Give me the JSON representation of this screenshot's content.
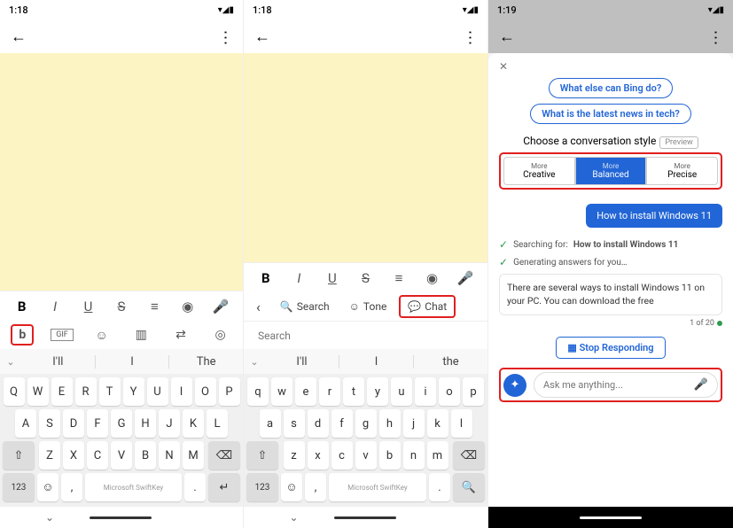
{
  "time1": "1:18",
  "time2": "1:18",
  "time3": "1:19",
  "signals": "▾◢▮",
  "fmt": {
    "b": "B",
    "i": "I",
    "u": "U",
    "s": "S",
    "list": "≡",
    "cam": "◉",
    "mic": "🎤"
  },
  "toolbar": {
    "bing": "b",
    "gif": "GIF",
    "sticker": "☺",
    "clip": "▥",
    "trans": "⇄",
    "set": "◎"
  },
  "modes": {
    "back": "‹",
    "search": "Search",
    "tone": "Tone",
    "chat": "Chat",
    "placeholder": "Search"
  },
  "pred1": {
    "w1": "I'll",
    "w2": "I",
    "w3": "The"
  },
  "pred2": {
    "w1": "I'll",
    "w2": "I",
    "w3": "the"
  },
  "keys": {
    "r1": [
      "Q",
      "W",
      "E",
      "R",
      "T",
      "Y",
      "U",
      "I",
      "O",
      "P"
    ],
    "r1l": [
      "q",
      "w",
      "e",
      "r",
      "t",
      "y",
      "u",
      "i",
      "o",
      "p"
    ],
    "r2": [
      "A",
      "S",
      "D",
      "F",
      "G",
      "H",
      "J",
      "K",
      "L"
    ],
    "r2l": [
      "a",
      "s",
      "d",
      "f",
      "g",
      "h",
      "j",
      "k",
      "l"
    ],
    "r3": [
      "Z",
      "X",
      "C",
      "V",
      "B",
      "N",
      "M"
    ],
    "r3l": [
      "z",
      "x",
      "c",
      "v",
      "b",
      "n",
      "m"
    ],
    "shift": "⇧",
    "del": "⌫",
    "num": "123",
    "emoji": "☺",
    "comma": ",",
    "space": "Microsoft SwiftKey",
    "dot": ".",
    "enter": "↵",
    "search": "🔍"
  },
  "chat": {
    "sug1": "What else can Bing do?",
    "sug2": "What is the latest news in tech?",
    "styleLabel": "Choose a conversation style",
    "preview": "Preview",
    "s1t": "More",
    "s1": "Creative",
    "s2t": "More",
    "s2": "Balanced",
    "s3t": "More",
    "s3": "Precise",
    "user": "How to install Windows 11",
    "searching": "Searching for:",
    "searchq": "How to install Windows 11",
    "gen": "Generating answers for you…",
    "answer": "There are several ways to install Windows 11 on your PC. You can download the free",
    "page": "1 of 20",
    "stop": "Stop Responding",
    "askPlaceholder": "Ask me anything..."
  }
}
